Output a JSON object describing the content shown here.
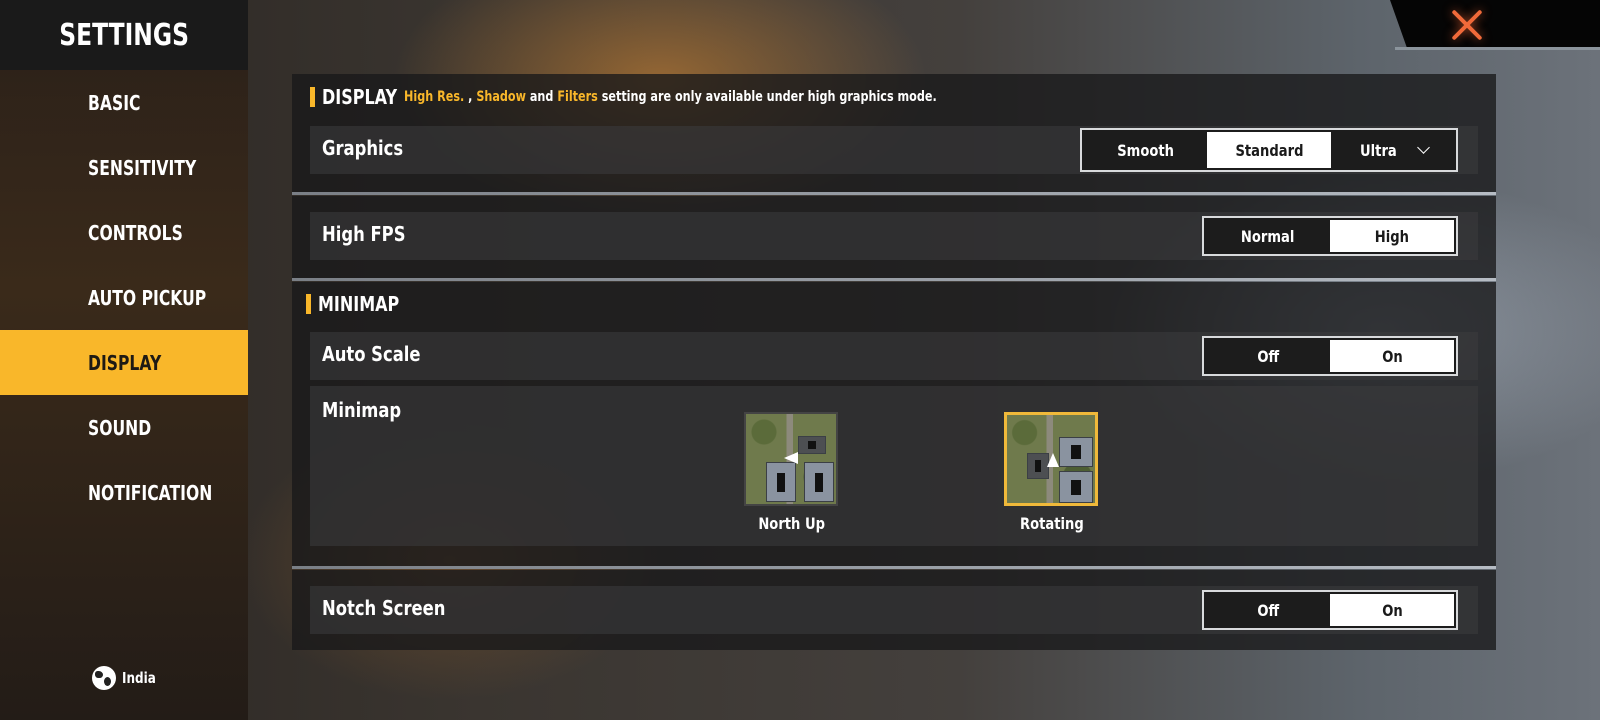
{
  "sidebar": {
    "title": "SETTINGS",
    "items": [
      {
        "label": "BASIC",
        "active": false
      },
      {
        "label": "SENSITIVITY",
        "active": false
      },
      {
        "label": "CONTROLS",
        "active": false
      },
      {
        "label": "AUTO PICKUP",
        "active": false
      },
      {
        "label": "DISPLAY",
        "active": true
      },
      {
        "label": "SOUND",
        "active": false
      },
      {
        "label": "NOTIFICATION",
        "active": false
      }
    ],
    "region": {
      "icon": "globe-icon",
      "label": "India"
    }
  },
  "close": {
    "icon": "close-icon"
  },
  "display": {
    "title": "DISPLAY",
    "note": {
      "hl1": "High Res.",
      "sep1": " , ",
      "hl2": "Shadow",
      "sep2": " and ",
      "hl3": "Filters",
      "rest": " setting are only available under high graphics mode."
    },
    "graphics": {
      "label": "Graphics",
      "options": [
        "Smooth",
        "Standard",
        "Ultra"
      ],
      "selected": "Standard"
    },
    "high_fps": {
      "label": "High FPS",
      "options": [
        "Normal",
        "High"
      ],
      "selected": "High"
    }
  },
  "minimap": {
    "title": "MINIMAP",
    "auto_scale": {
      "label": "Auto Scale",
      "options": [
        "Off",
        "On"
      ],
      "selected": "On"
    },
    "mode": {
      "label": "Minimap",
      "options": [
        "North Up",
        "Rotating"
      ],
      "selected": "Rotating"
    }
  },
  "notch": {
    "label": "Notch Screen",
    "options": [
      "Off",
      "On"
    ],
    "selected": "On"
  },
  "colors": {
    "accent": "#f9b72a",
    "close": "#f06a3a"
  }
}
